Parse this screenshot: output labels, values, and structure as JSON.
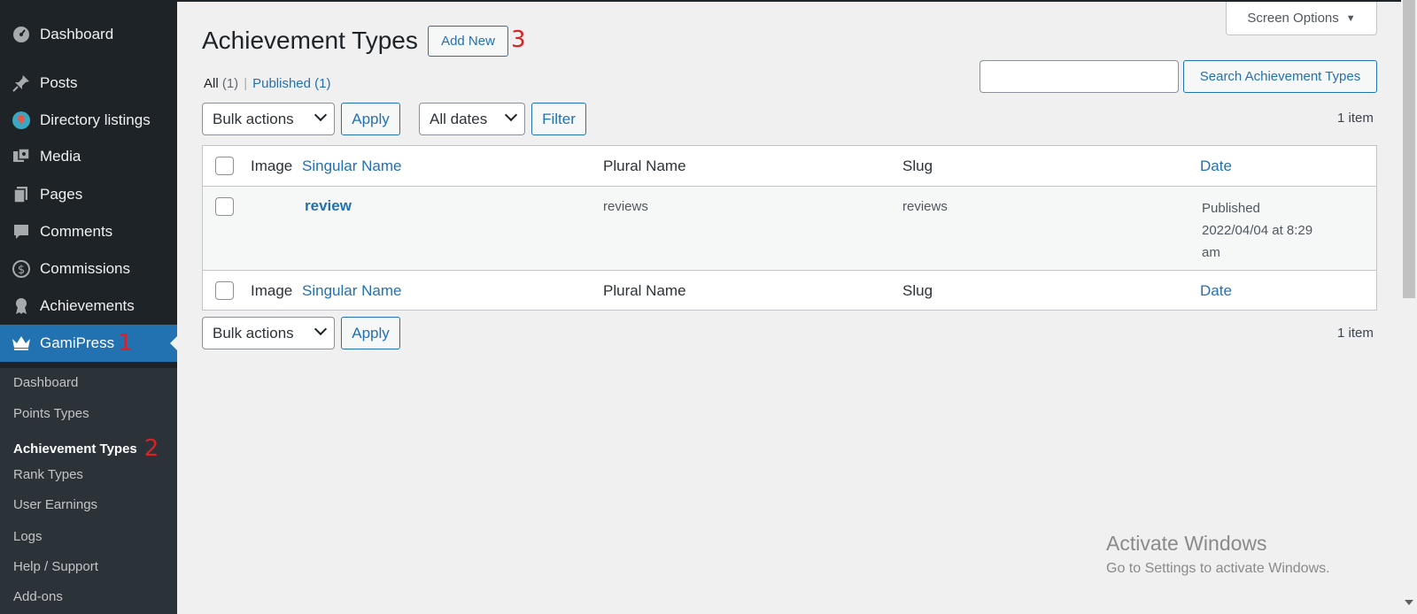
{
  "sidebar": {
    "items": [
      {
        "label": "Dashboard",
        "icon": "dashboard-icon"
      },
      {
        "label": "Posts",
        "icon": "pushpin-icon"
      },
      {
        "label": "Directory listings",
        "icon": "directory-icon"
      },
      {
        "label": "Media",
        "icon": "media-icon"
      },
      {
        "label": "Pages",
        "icon": "pages-icon"
      },
      {
        "label": "Comments",
        "icon": "comment-icon"
      },
      {
        "label": "Commissions",
        "icon": "dollar-icon"
      },
      {
        "label": "Achievements",
        "icon": "award-icon"
      },
      {
        "label": "GamiPress",
        "icon": "crown-icon",
        "annotation": "1",
        "active": true
      }
    ],
    "submenu": [
      {
        "label": "Dashboard"
      },
      {
        "label": "Points Types"
      },
      {
        "label": "Achievement Types",
        "annotation": "2",
        "current": true
      },
      {
        "label": "Rank Types"
      },
      {
        "label": "User Earnings"
      },
      {
        "label": "Logs"
      },
      {
        "label": "Help / Support"
      },
      {
        "label": "Add-ons"
      }
    ]
  },
  "header": {
    "screen_options": "Screen Options",
    "title": "Achievement Types",
    "add_new": "Add New",
    "add_new_annotation": "3"
  },
  "views": {
    "all_label": "All",
    "all_count": "(1)",
    "separator": "|",
    "published_label": "Published",
    "published_count": "(1)"
  },
  "search": {
    "value": "",
    "button": "Search Achievement Types"
  },
  "tablenav_top": {
    "bulk_actions": "Bulk actions",
    "apply": "Apply",
    "dates": "All dates",
    "filter": "Filter",
    "count": "1 item"
  },
  "table": {
    "columns": [
      "Image",
      "Singular Name",
      "Plural Name",
      "Slug",
      "Date"
    ],
    "rows": [
      {
        "singular": "review",
        "plural": "reviews",
        "slug": "reviews",
        "date_status": "Published",
        "date_line1": "2022/04/04 at 8:29",
        "date_line2": "am"
      }
    ]
  },
  "tablenav_bottom": {
    "bulk_actions": "Bulk actions",
    "apply": "Apply",
    "count": "1 item"
  },
  "watermark": {
    "title": "Activate Windows",
    "subtitle": "Go to Settings to activate Windows."
  },
  "colors": {
    "sidebar_bg": "#1d2327",
    "submenu_bg": "#2c3338",
    "accent": "#2271b1",
    "annotation": "#e02020"
  }
}
